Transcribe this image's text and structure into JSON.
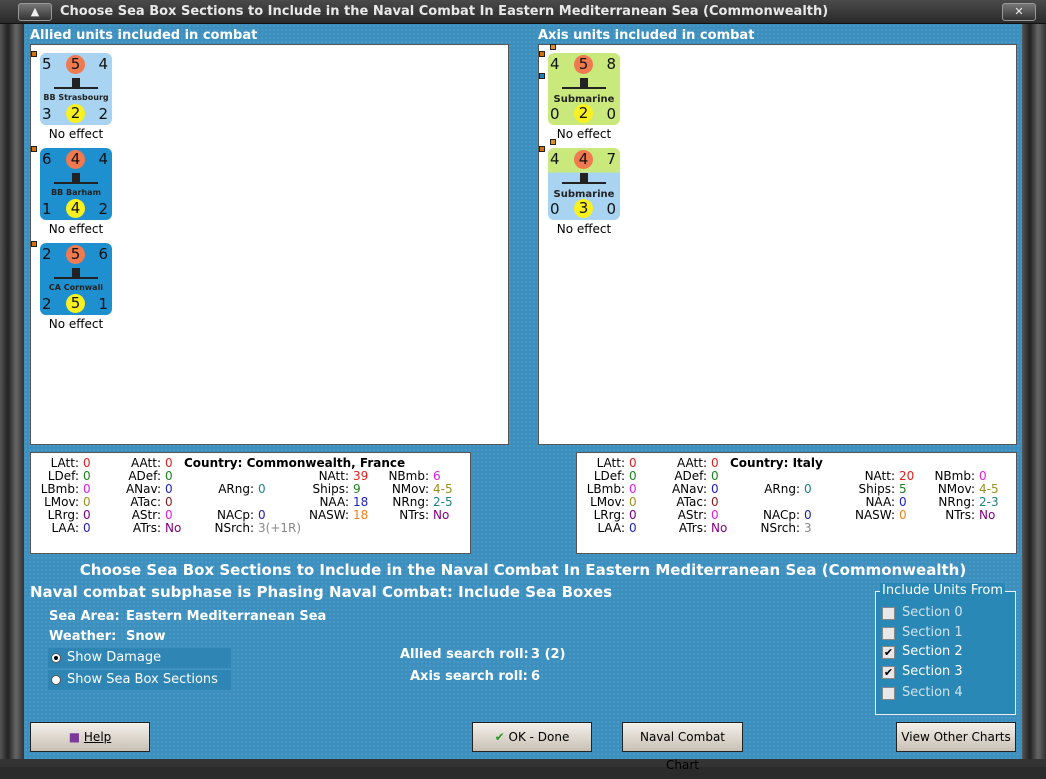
{
  "window": {
    "title": "Choose Sea Box Sections to Include in the Naval Combat In Eastern Mediterranean Sea (Commonwealth)"
  },
  "allied": {
    "header": "Allied units included in combat",
    "units": [
      {
        "name": "BB Strasbourg",
        "tl": "5",
        "tc": "5",
        "tr": "4",
        "bl": "3",
        "bc": "2",
        "br": "2",
        "effect": "No effect",
        "color": "#a8d4f2",
        "color2": "#a8d4f2"
      },
      {
        "name": "BB Barham",
        "tl": "6",
        "tc": "4",
        "tr": "4",
        "bl": "1",
        "bc": "4",
        "br": "2",
        "effect": "No effect",
        "color": "#1e90cf",
        "color2": "#1e90cf"
      },
      {
        "name": "CA Cornwall",
        "tl": "2",
        "tc": "5",
        "tr": "6",
        "bl": "2",
        "bc": "5",
        "br": "1",
        "effect": "No effect",
        "color": "#1e90cf",
        "color2": "#1e90cf"
      }
    ]
  },
  "axis": {
    "header": "Axis units included in combat",
    "units": [
      {
        "name": "Submarine",
        "tl": "4",
        "tc": "5",
        "tr": "8",
        "bl": "0",
        "bc": "2",
        "br": "0",
        "effect": "No effect",
        "color": "#c9e97c",
        "color2": "#c9e97c"
      },
      {
        "name": "Submarine",
        "tl": "4",
        "tc": "4",
        "tr": "7",
        "bl": "0",
        "bc": "3",
        "br": "0",
        "effect": "No effect",
        "color": "#c9e97c",
        "color2": "#a8d4f2"
      }
    ]
  },
  "allied_stats": {
    "country": "Country: Commonwealth, France",
    "items": [
      [
        "LAtt:",
        "0",
        "#e02020"
      ],
      [
        "LDef:",
        "0",
        "#208020"
      ],
      [
        "LBmb:",
        "0",
        "#e020e0"
      ],
      [
        "LMov:",
        "0",
        "#9a9020"
      ],
      [
        "LRrg:",
        "0",
        "#800080"
      ],
      [
        "LAA:",
        "0",
        "#2020c0"
      ],
      [
        "AAtt:",
        "0",
        "#e02020"
      ],
      [
        "ADef:",
        "0",
        "#208020"
      ],
      [
        "ANav:",
        "0",
        "#2020c0"
      ],
      [
        "ATac:",
        "0",
        "#802020"
      ],
      [
        "AStr:",
        "0",
        "#e020e0"
      ],
      [
        "ATrs:",
        "No",
        "#800080"
      ],
      [
        "ARng:",
        "0",
        "#208080"
      ],
      [
        "NACp:",
        "0",
        "#2020a0"
      ],
      [
        "NSrch:",
        "3(+1R)",
        "#888888"
      ],
      [
        "NAtt:",
        "39",
        "#e02020"
      ],
      [
        "Ships:",
        "9",
        "#208020"
      ],
      [
        "NAA:",
        "18",
        "#2020c0"
      ],
      [
        "NASW:",
        "18",
        "#f08020"
      ],
      [
        "NBmb:",
        "6",
        "#e020e0"
      ],
      [
        "NMov:",
        "4-5",
        "#9a9020"
      ],
      [
        "NRng:",
        "2-5",
        "#208080"
      ],
      [
        "NTrs:",
        "No",
        "#800080"
      ]
    ]
  },
  "axis_stats": {
    "country": "Country: Italy",
    "items": [
      [
        "LAtt:",
        "0",
        "#e02020"
      ],
      [
        "LDef:",
        "0",
        "#208020"
      ],
      [
        "LBmb:",
        "0",
        "#e020e0"
      ],
      [
        "LMov:",
        "0",
        "#9a9020"
      ],
      [
        "LRrg:",
        "0",
        "#800080"
      ],
      [
        "LAA:",
        "0",
        "#2020c0"
      ],
      [
        "AAtt:",
        "0",
        "#e02020"
      ],
      [
        "ADef:",
        "0",
        "#208020"
      ],
      [
        "ANav:",
        "0",
        "#2020c0"
      ],
      [
        "ATac:",
        "0",
        "#802020"
      ],
      [
        "AStr:",
        "0",
        "#e020e0"
      ],
      [
        "ATrs:",
        "No",
        "#800080"
      ],
      [
        "ARng:",
        "0",
        "#208080"
      ],
      [
        "NACp:",
        "0",
        "#2020a0"
      ],
      [
        "NSrch:",
        "3",
        "#888888"
      ],
      [
        "NAtt:",
        "20",
        "#e02020"
      ],
      [
        "Ships:",
        "5",
        "#208020"
      ],
      [
        "NAA:",
        "0",
        "#2020c0"
      ],
      [
        "NASW:",
        "0",
        "#f08020"
      ],
      [
        "NBmb:",
        "0",
        "#e020e0"
      ],
      [
        "NMov:",
        "4-5",
        "#9a9020"
      ],
      [
        "NRng:",
        "2-3",
        "#208080"
      ],
      [
        "NTrs:",
        "No",
        "#800080"
      ]
    ]
  },
  "center_title": "Choose Sea Box Sections to Include in the Naval Combat In Eastern Mediterranean Sea (Commonwealth)",
  "subphase": "Naval combat subphase is Phasing Naval Combat: Include Sea Boxes",
  "sea_area_label": "Sea Area:",
  "sea_area": "Eastern Mediterranean Sea",
  "weather_label": "Weather:",
  "weather": "Snow",
  "radios": [
    {
      "label": "Show Damage",
      "selected": true
    },
    {
      "label": "Show Sea Box Sections",
      "selected": false
    }
  ],
  "allied_roll_label": "Allied search roll:",
  "allied_roll": "3 (2)",
  "axis_roll_label": "Axis search roll:",
  "axis_roll": "6",
  "include": {
    "title": "Include Units From",
    "sections": [
      {
        "label": "Section 0",
        "checked": false
      },
      {
        "label": "Section 1",
        "checked": false
      },
      {
        "label": "Section 2",
        "checked": true
      },
      {
        "label": "Section 3",
        "checked": true
      },
      {
        "label": "Section 4",
        "checked": false
      }
    ]
  },
  "buttons": {
    "help": "Help",
    "ok": "OK - Done",
    "naval_chart": "Naval Combat Chart",
    "other_charts": "View Other Charts"
  }
}
